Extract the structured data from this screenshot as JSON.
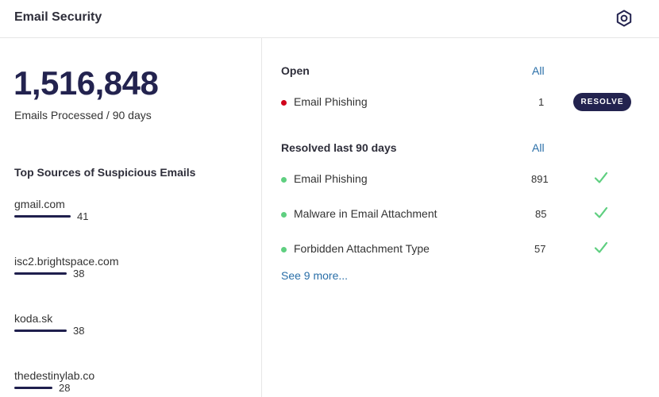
{
  "header": {
    "title": "Email Security",
    "settings_icon": "settings-hexagon-icon"
  },
  "stats": {
    "emails_processed": "1,516,848",
    "emails_processed_label": "Emails Processed / 90 days"
  },
  "sources": {
    "title": "Top Sources of Suspicious Emails",
    "items": [
      {
        "name": "gmail.com",
        "count": "41"
      },
      {
        "name": "isc2.brightspace.com",
        "count": "38"
      },
      {
        "name": "koda.sk",
        "count": "38"
      },
      {
        "name": "thedestinylab.co",
        "count": "28"
      }
    ]
  },
  "open": {
    "title": "Open",
    "all_label": "All",
    "items": [
      {
        "label": "Email Phishing",
        "count": "1",
        "status_color": "#d0021b",
        "action": "RESOLVE"
      }
    ]
  },
  "resolved": {
    "title": "Resolved last 90 days",
    "all_label": "All",
    "items": [
      {
        "label": "Email Phishing",
        "count": "891",
        "status_color": "#5fcf80",
        "icon": "check-icon"
      },
      {
        "label": "Malware in Email Attachment",
        "count": "85",
        "status_color": "#5fcf80",
        "icon": "check-icon"
      },
      {
        "label": "Forbidden Attachment Type",
        "count": "57",
        "status_color": "#5fcf80",
        "icon": "check-icon"
      }
    ],
    "see_more": "See 9 more..."
  },
  "colors": {
    "brand_navy": "#23234f",
    "link_blue": "#2a6fa8",
    "open_red": "#d0021b",
    "resolved_green": "#5fcf80"
  }
}
